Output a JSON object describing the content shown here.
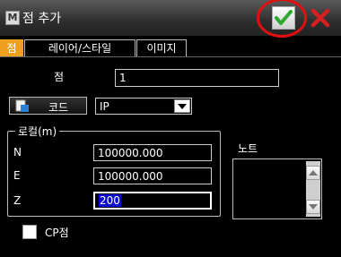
{
  "window": {
    "title": "점 추가",
    "app_icon_letter": "M"
  },
  "tabs": [
    {
      "label": "점",
      "active": true
    },
    {
      "label": "레이어/스타일",
      "active": false
    },
    {
      "label": "이미지",
      "active": false
    }
  ],
  "point": {
    "label": "점",
    "value": "1"
  },
  "code": {
    "button_label": "코드",
    "value": "IP"
  },
  "local": {
    "group_title": "로컬(m)",
    "n_label": "N",
    "n_value": "100000.000",
    "e_label": "E",
    "e_value": "100000.000",
    "z_label": "Z",
    "z_value": "200"
  },
  "notes": {
    "label": "노트"
  },
  "cp_point": {
    "label": "CP점",
    "checked": false
  },
  "colors": {
    "accent_tab": "#f0a020",
    "ok_check": "#2ea82e",
    "cancel_x": "#d42020",
    "selection": "#0a0ad0",
    "highlight_ring": "#e01010"
  }
}
